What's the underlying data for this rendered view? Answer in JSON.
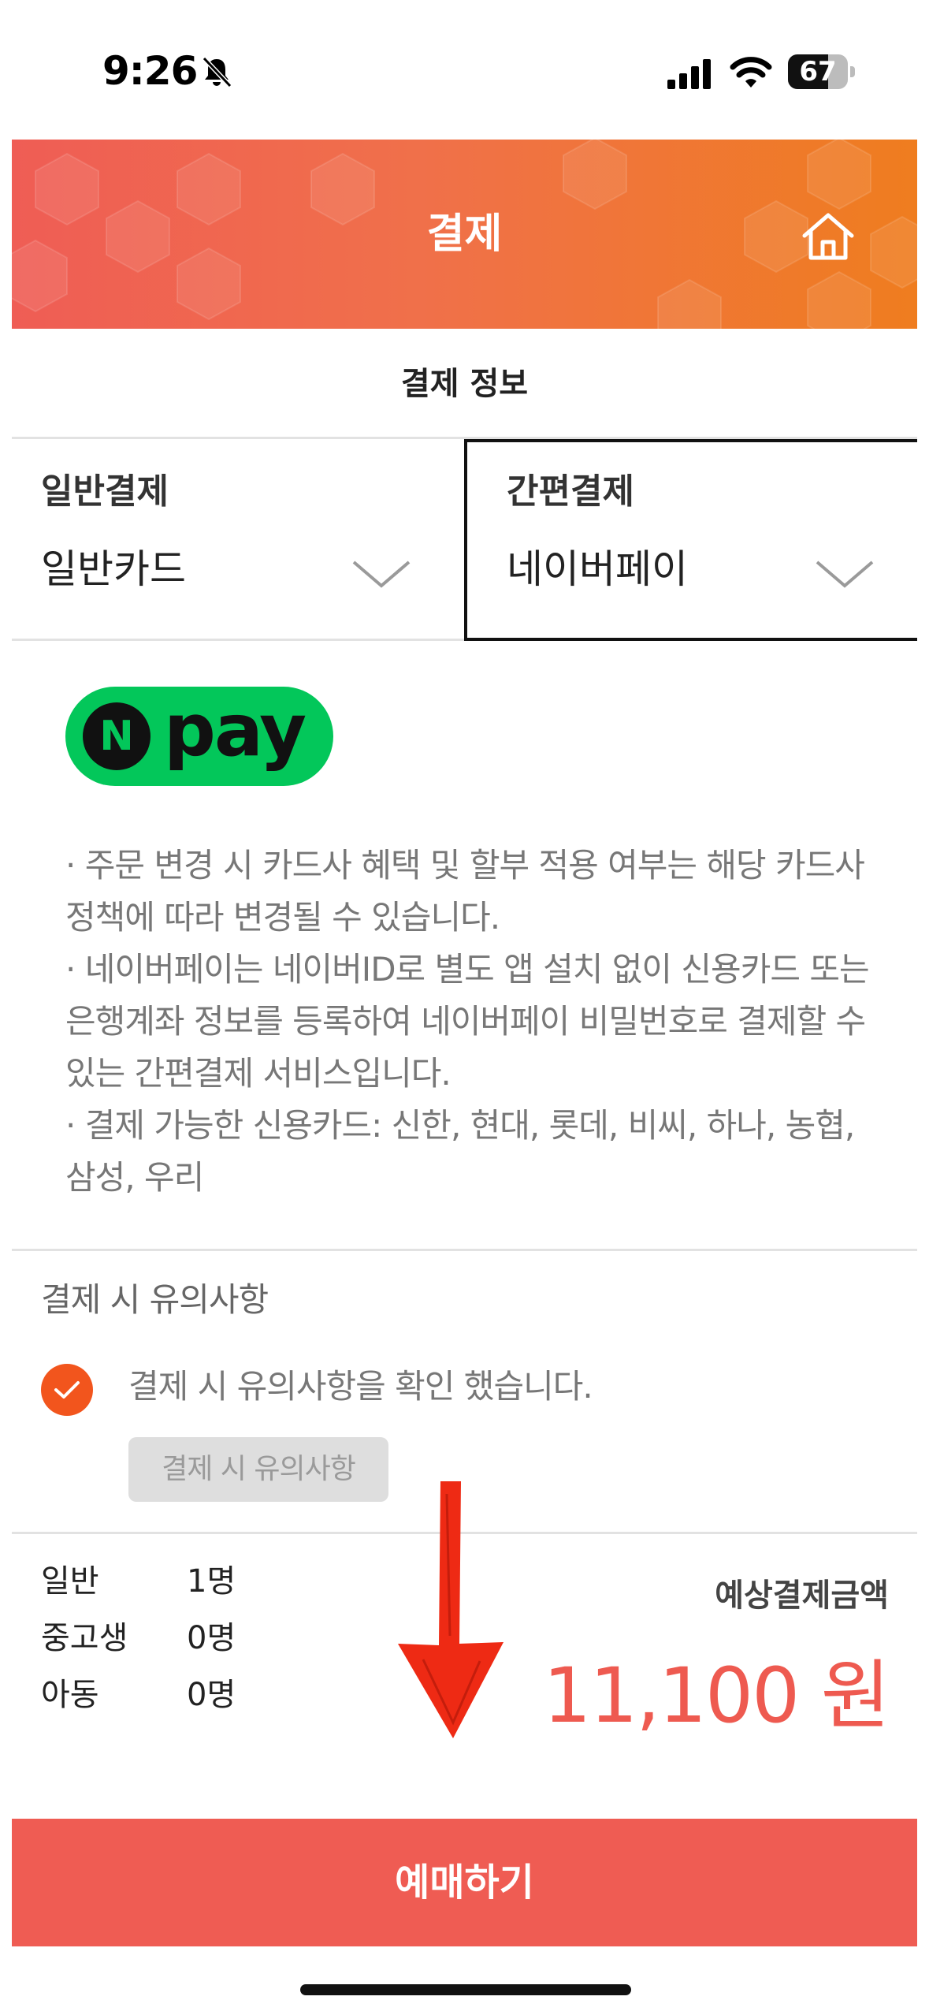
{
  "status_bar": {
    "time": "9:26",
    "battery": "67",
    "battery_level": 0.67,
    "icons": [
      "bell-slash-icon",
      "cellular-signal-icon",
      "wifi-icon",
      "battery-icon"
    ]
  },
  "header": {
    "title": "결제",
    "home_icon": "home-icon",
    "gradient_colors": [
      "#ef5d55",
      "#ef7d1f"
    ]
  },
  "section_title": "결제 정보",
  "payment": {
    "general": {
      "label": "일반결제",
      "value": "일반카드"
    },
    "simple": {
      "label": "간편결제",
      "value": "네이버페이",
      "selected": true
    }
  },
  "npay": {
    "logo_letter": "N",
    "logo_text": "pay",
    "logo_color": "#03c75a",
    "notes": [
      "· 주문 변경 시 카드사 혜택 및 할부 적용 여부는 해당 카드사 정책에 따라 변경될 수 있습니다.",
      "· 네이버페이는 네이버ID로 별도 앱 설치 없이 신용카드 또는 은행계좌 정보를 등록하여 네이버페이 비밀번호로 결제할 수 있는 간편결제 서비스입니다.",
      "· 결제 가능한 신용카드: 신한, 현대, 롯데, 비씨, 하나, 농협, 삼성, 우리"
    ]
  },
  "caution": {
    "title": "결제 시 유의사항",
    "check_label": "결제 시 유의사항을 확인 했습니다.",
    "checked": true,
    "button": "결제 시 유의사항",
    "check_color": "#f2551d"
  },
  "counts": [
    {
      "label": "일반",
      "value": "1명"
    },
    {
      "label": "중고생",
      "value": "0명"
    },
    {
      "label": "아동",
      "value": "0명"
    }
  ],
  "estimate": {
    "label": "예상결제금액",
    "amount": "11,100 원",
    "amount_color": "#ee5a50"
  },
  "book_button": {
    "label": "예매하기",
    "color": "#ef5c53"
  }
}
